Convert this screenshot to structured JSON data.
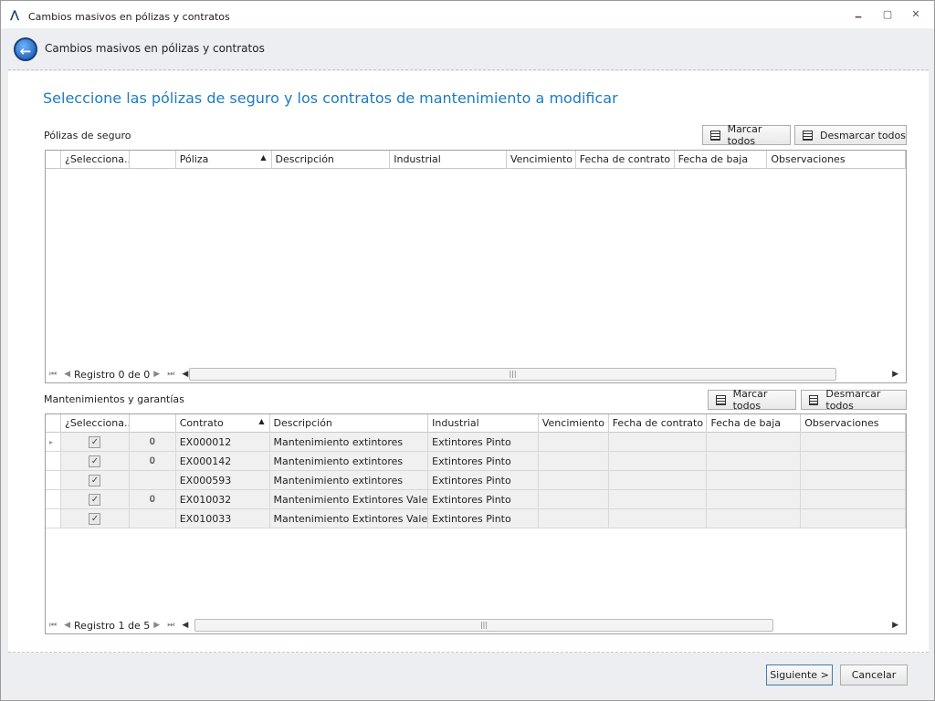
{
  "window": {
    "title": "Cambios masivos en pólizas y contratos",
    "minimize": "🗕",
    "restore": "▢",
    "close": "✕"
  },
  "header": {
    "title": "Cambios masivos en pólizas y contratos",
    "back": "←"
  },
  "main": {
    "heading": "Seleccione las pólizas de seguro y los contratos de mantenimiento a modificar"
  },
  "polizas": {
    "label": "Pólizas de seguro",
    "marcar": "Marcar todos",
    "desmarcar": "Desmarcar todos",
    "columns": [
      "¿Selecciona...",
      "",
      "Póliza",
      "Descripción",
      "Industrial",
      "Vencimiento",
      "Fecha de contrato",
      "Fecha de baja",
      "Observaciones"
    ],
    "record": "Registro 0 de 0"
  },
  "mantenimientos": {
    "label": "Mantenimientos y garantías",
    "marcar": "Marcar todos",
    "desmarcar": "Desmarcar todos",
    "columns": [
      "¿Selecciona...",
      "",
      "Contrato",
      "Descripción",
      "Industrial",
      "Vencimiento",
      "Fecha de contrato",
      "Fecha de baja",
      "Observaciones"
    ],
    "rows": [
      {
        "checked": true,
        "attach": true,
        "contrato": "EX000012",
        "descripcion": "Mantenimiento extintores",
        "industrial": "Extintores Pinto"
      },
      {
        "checked": true,
        "attach": true,
        "contrato": "EX000142",
        "descripcion": "Mantenimiento extintores",
        "industrial": "Extintores Pinto"
      },
      {
        "checked": true,
        "attach": false,
        "contrato": "EX000593",
        "descripcion": "Mantenimiento extintores",
        "industrial": "Extintores Pinto"
      },
      {
        "checked": true,
        "attach": true,
        "contrato": "EX010032",
        "descripcion": "Mantenimiento Extintores Valenc...",
        "industrial": "Extintores Pinto"
      },
      {
        "checked": true,
        "attach": false,
        "contrato": "EX010033",
        "descripcion": "Mantenimiento Extintores Valenc...",
        "industrial": "Extintores Pinto"
      }
    ],
    "record": "Registro 1 de 5"
  },
  "buttons": {
    "siguiente": "Siguiente >",
    "cancelar": "Cancelar"
  }
}
